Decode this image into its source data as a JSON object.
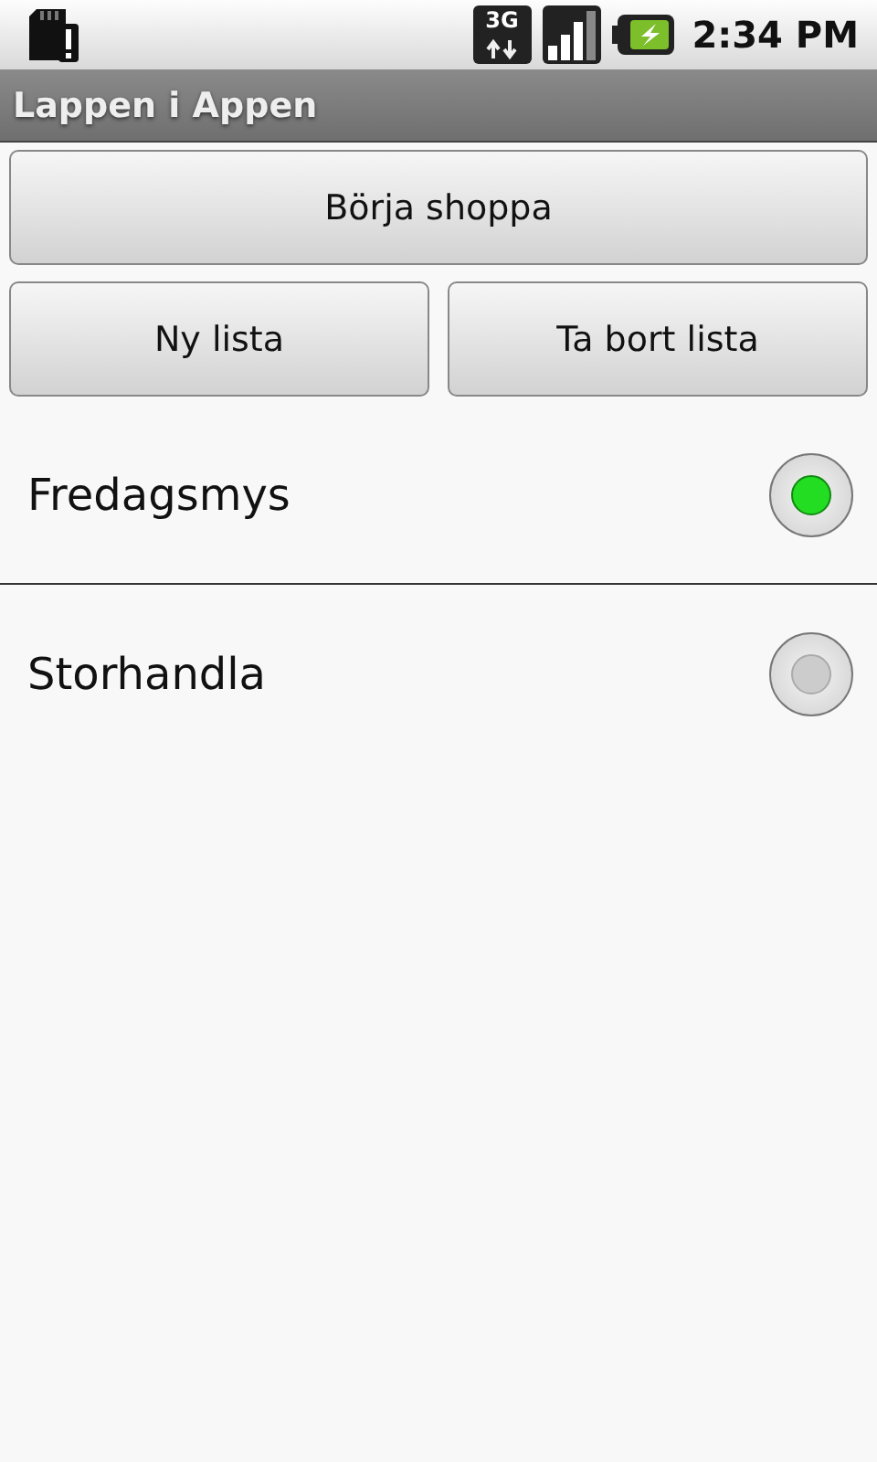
{
  "status_bar": {
    "network_type": "3G",
    "time": "2:34 PM"
  },
  "window": {
    "title": "Lappen i Appen"
  },
  "primary_button": "Börja shoppa",
  "buttons": [
    "Ny lista",
    "Ta bort lista"
  ],
  "lists": [
    {
      "name": "Fredagsmys",
      "selected": true
    },
    {
      "name": "Storhandla",
      "selected": false
    }
  ]
}
